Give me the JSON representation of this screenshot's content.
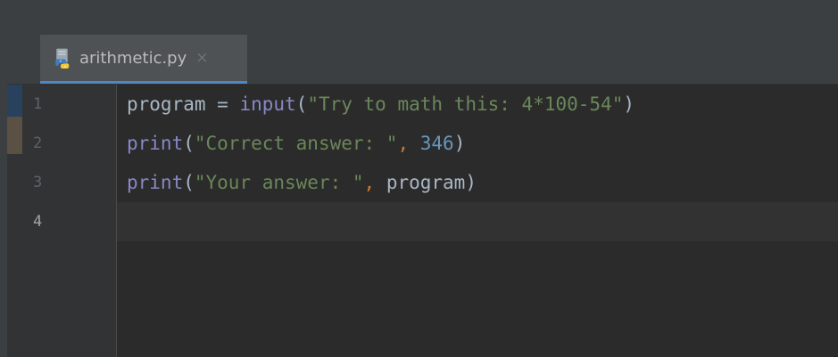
{
  "editor": {
    "tab": {
      "filename": "arithmetic.py",
      "close_glyph": "×",
      "icon": "python-file-icon"
    },
    "lines": [
      {
        "number": "1",
        "tokens": [
          {
            "text": "program",
            "kind": "ident"
          },
          {
            "text": " = ",
            "kind": "ident"
          },
          {
            "text": "input",
            "kind": "builtin"
          },
          {
            "text": "(",
            "kind": "ident"
          },
          {
            "text": "\"Try to math this: 4*100-54\"",
            "kind": "string"
          },
          {
            "text": ")",
            "kind": "ident"
          }
        ]
      },
      {
        "number": "2",
        "tokens": [
          {
            "text": "print",
            "kind": "builtin"
          },
          {
            "text": "(",
            "kind": "ident"
          },
          {
            "text": "\"Correct answer: \"",
            "kind": "string"
          },
          {
            "text": ", ",
            "kind": "punct"
          },
          {
            "text": "346",
            "kind": "number"
          },
          {
            "text": ")",
            "kind": "ident"
          }
        ]
      },
      {
        "number": "3",
        "tokens": [
          {
            "text": "print",
            "kind": "builtin"
          },
          {
            "text": "(",
            "kind": "ident"
          },
          {
            "text": "\"Your answer: \"",
            "kind": "string"
          },
          {
            "text": ", ",
            "kind": "punct"
          },
          {
            "text": "program",
            "kind": "ident"
          },
          {
            "text": ")",
            "kind": "ident"
          }
        ]
      },
      {
        "number": "4",
        "tokens": []
      }
    ],
    "current_line": 4
  },
  "colors": {
    "background": "#2b2b2b",
    "gutter": "#313335",
    "current_line": "#323232",
    "identifier": "#a9b7c6",
    "builtin": "#8888c6",
    "string": "#6a8759",
    "number": "#6897bb",
    "punctuation": "#cc7832",
    "tab_underline": "#4a88c7",
    "bookmark_blue": "#28415c",
    "bookmark_tan": "#5a5043"
  }
}
